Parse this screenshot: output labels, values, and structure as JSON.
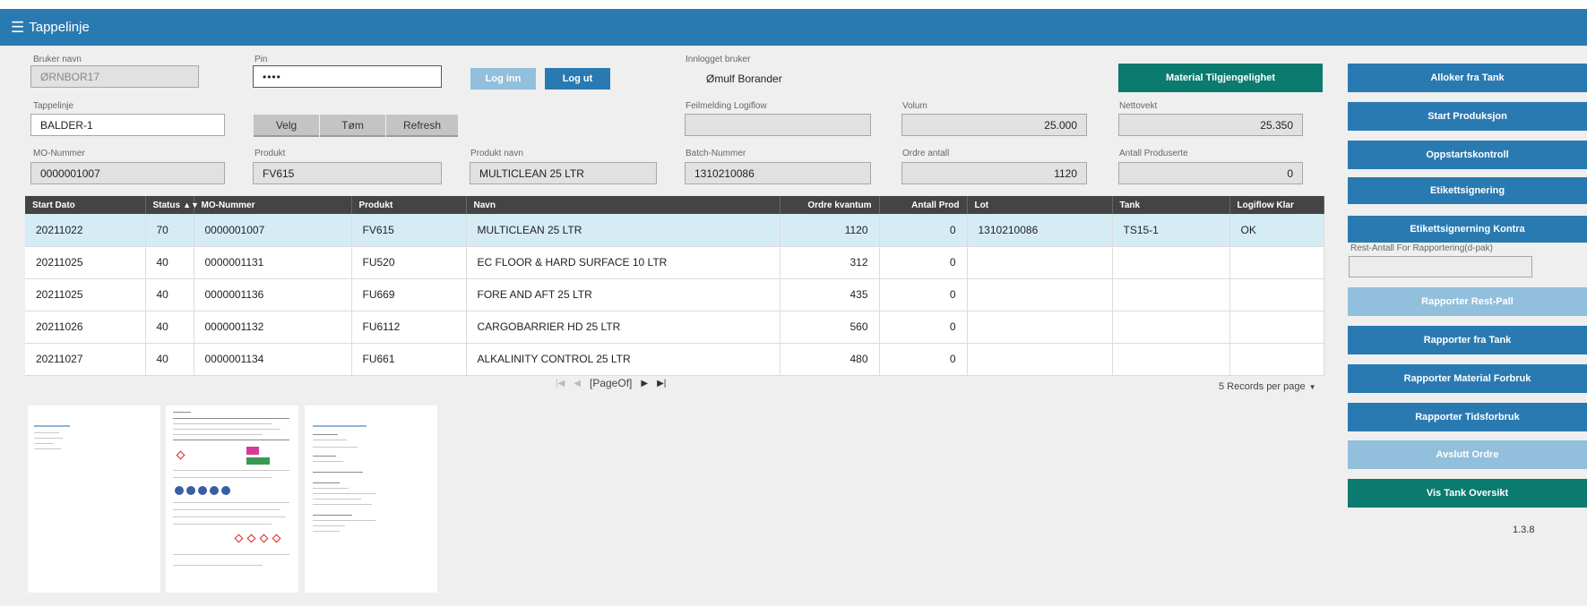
{
  "app": {
    "title": "Tappelinje",
    "menu_icon": "menu-icon"
  },
  "form": {
    "bruker_navn": {
      "label": "Bruker navn",
      "value": "ØRNBOR17"
    },
    "pin": {
      "label": "Pin",
      "value": "••••"
    },
    "login_button": "Log inn",
    "logout_button": "Log ut",
    "innlogget_bruker": {
      "label": "Innlogget bruker",
      "value": "Ømulf Borander"
    },
    "tappelinje": {
      "label": "Tappelinje",
      "value": "BALDER-1"
    },
    "velg_button": "Velg",
    "tom_button": "Tøm",
    "refresh_button": "Refresh",
    "feilmelding": {
      "label": "Feilmelding Logiflow",
      "value": ""
    },
    "volum": {
      "label": "Volum",
      "value": "25.000"
    },
    "nettovekt": {
      "label": "Nettovekt",
      "value": "25.350"
    },
    "mo_nummer": {
      "label": "MO-Nummer",
      "value": "0000001007"
    },
    "produkt": {
      "label": "Produkt",
      "value": "FV615"
    },
    "produkt_navn": {
      "label": "Produkt navn",
      "value": "MULTICLEAN  25 LTR"
    },
    "batch_nummer": {
      "label": "Batch-Nummer",
      "value": "1310210086"
    },
    "ordre_antall": {
      "label": "Ordre antall",
      "value": "1120"
    },
    "antall_produserte": {
      "label": "Antall Produserte",
      "value": "0"
    }
  },
  "table": {
    "columns": [
      "Start Dato",
      "Status",
      "MO-Nummer",
      "Produkt",
      "Navn",
      "Ordre kvantum",
      "Antall Prod",
      "Lot",
      "Tank",
      "Logiflow Klar"
    ],
    "rows": [
      [
        "20211022",
        "70",
        "0000001007",
        "FV615",
        "MULTICLEAN 25 LTR",
        "1120",
        "0",
        "1310210086",
        "TS15-1",
        "OK"
      ],
      [
        "20211025",
        "40",
        "0000001131",
        "FU520",
        "EC FLOOR & HARD SURFACE 10 LTR",
        "312",
        "0",
        "",
        "",
        ""
      ],
      [
        "20211025",
        "40",
        "0000001136",
        "FU669",
        "FORE AND AFT 25 LTR",
        "435",
        "0",
        "",
        "",
        ""
      ],
      [
        "20211026",
        "40",
        "0000001132",
        "FU6112",
        "CARGOBARRIER HD 25 LTR",
        "560",
        "0",
        "",
        "",
        ""
      ],
      [
        "20211027",
        "40",
        "0000001134",
        "FU661",
        "ALKALINITY CONTROL 25 LTR",
        "480",
        "0",
        "",
        "",
        ""
      ]
    ]
  },
  "pager": {
    "text": "[PageOf]",
    "records_per_page": "5 Records per page"
  },
  "side": {
    "material_button": "Material Tilgjengelighet",
    "buttons": [
      {
        "label": "Alloker fra Tank",
        "state": "active"
      },
      {
        "label": "Start Produksjon",
        "state": "active"
      },
      {
        "label": "Oppstartskontroll",
        "state": "active"
      },
      {
        "label": "Etikettsignering",
        "state": "active"
      },
      {
        "label": "Etikettsignerning Kontra",
        "state": "active"
      },
      {
        "label": "Rapporter Rest-Pall",
        "state": "disabled"
      },
      {
        "label": "Rapporter fra Tank",
        "state": "active"
      },
      {
        "label": "Rapporter Material Forbruk",
        "state": "active"
      },
      {
        "label": "Rapporter Tidsforbruk",
        "state": "active"
      },
      {
        "label": "Avslutt Ordre",
        "state": "disabled"
      },
      {
        "label": "Vis Tank Oversikt",
        "state": "teal"
      }
    ],
    "rest_antall_label": "Rest-Antall For Rapportering(d-pak)",
    "rest_antall_value": "",
    "version": "1.3.8"
  },
  "colors": {
    "header": "#2a7ab2",
    "button": "#2a7ab2",
    "button_disabled": "#92bfdc",
    "teal": "#0b7a6f",
    "row_selected": "#d6ecf5"
  }
}
